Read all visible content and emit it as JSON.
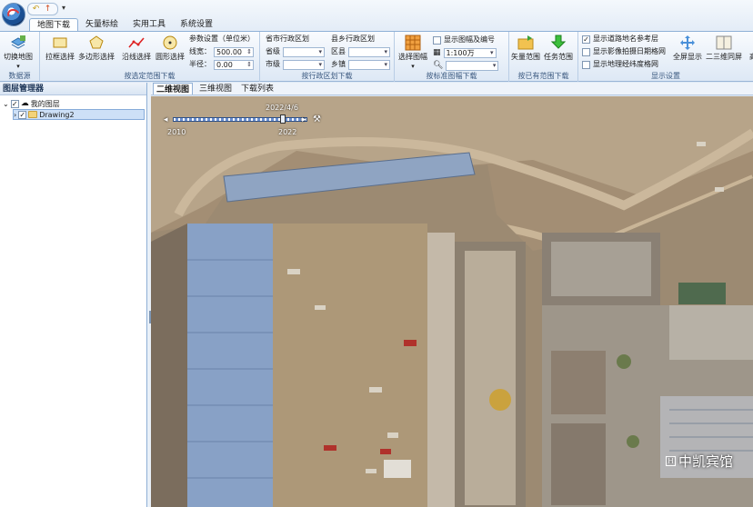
{
  "tabs": [
    "地图下载",
    "矢量标绘",
    "实用工具",
    "系统设置"
  ],
  "active_tab": "地图下载",
  "ribbon": {
    "datasource": {
      "button": "切换地图",
      "label": "数据源"
    },
    "range_select": {
      "buttons": [
        "拉框选择",
        "多边形选择",
        "沿线选择",
        "圆形选择"
      ],
      "params_title": "参数设置（单位米）",
      "line_width_label": "线宽：",
      "line_width_value": "500.00",
      "radius_label": "半径：",
      "radius_value": "0.00",
      "label": "按选定范围下载"
    },
    "province_city": {
      "title": "省市行政区划",
      "province": "省级",
      "city": "市级",
      "label": "按行政区划下载"
    },
    "county_town": {
      "title": "县乡行政区划",
      "county": "区县",
      "town": "乡镇"
    },
    "sheet": {
      "button": "选择图幅",
      "show_sheet": "显示图幅及编号",
      "scale": "1:100万",
      "label": "按标准图幅下载"
    },
    "existing": {
      "buttons": [
        "矢量范围",
        "任务范围"
      ],
      "label": "按已有范围下载"
    },
    "display": {
      "checks": [
        {
          "text": "显示道路地名参考层",
          "checked": true
        },
        {
          "text": "显示影像拍摄日期格网",
          "checked": false
        },
        {
          "text": "显示地理经纬度格网",
          "checked": false
        }
      ],
      "buttons": [
        "全屏显示",
        "二三维同屏",
        "高"
      ],
      "label": "显示设置"
    }
  },
  "layer_panel": {
    "title": "图层管理器",
    "tree": [
      {
        "text": "我的图层",
        "checked": true
      },
      {
        "text": "Drawing2",
        "checked": true
      }
    ]
  },
  "view_tabs": [
    "二维视图",
    "三维视图",
    "下载列表"
  ],
  "active_view": "二维视图",
  "map": {
    "date": "2022/4/6",
    "year_start": "2010",
    "year_end": "2022",
    "watermark": "中凯宾馆"
  }
}
